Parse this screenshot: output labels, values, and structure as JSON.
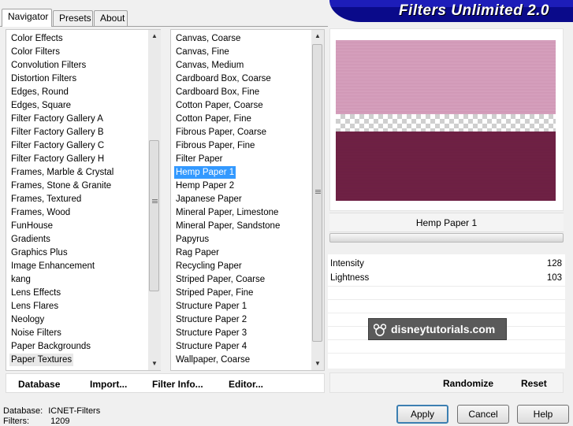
{
  "app": {
    "title": "Filters Unlimited 2.0"
  },
  "tabs": [
    {
      "label": "Navigator",
      "active": true
    },
    {
      "label": "Presets"
    },
    {
      "label": "About"
    }
  ],
  "categories": {
    "items": [
      "Color Effects",
      "Color Filters",
      "Convolution Filters",
      "Distortion Filters",
      "Edges, Round",
      "Edges, Square",
      "Filter Factory Gallery A",
      "Filter Factory Gallery B",
      "Filter Factory Gallery C",
      "Filter Factory Gallery H",
      "Frames, Marble & Crystal",
      "Frames, Stone & Granite",
      "Frames, Textured",
      "Frames, Wood",
      "FunHouse",
      "Gradients",
      "Graphics Plus",
      "Image Enhancement",
      "kang",
      "Lens Effects",
      "Lens Flares",
      "Neology",
      "Noise Filters",
      "Paper Backgrounds",
      "Paper Textures"
    ],
    "selected": "Paper Textures"
  },
  "filters": {
    "items": [
      "Canvas, Coarse",
      "Canvas, Fine",
      "Canvas, Medium",
      "Cardboard Box, Coarse",
      "Cardboard Box, Fine",
      "Cotton Paper, Coarse",
      "Cotton Paper, Fine",
      "Fibrous Paper, Coarse",
      "Fibrous Paper, Fine",
      "Filter Paper",
      "Hemp Paper 1",
      "Hemp Paper 2",
      "Japanese Paper",
      "Mineral Paper, Limestone",
      "Mineral Paper, Sandstone",
      "Papyrus",
      "Rag Paper",
      "Recycling Paper",
      "Striped Paper, Coarse",
      "Striped Paper, Fine",
      "Structure Paper 1",
      "Structure Paper 2",
      "Structure Paper 3",
      "Structure Paper 4",
      "Wallpaper, Coarse"
    ],
    "selected": "Hemp Paper 1"
  },
  "toolbar": {
    "database": "Database",
    "import": "Import...",
    "filter_info": "Filter Info...",
    "editor": "Editor..."
  },
  "preview": {
    "filter_name": "Hemp Paper 1",
    "colors": {
      "top": "#d29ab8",
      "bottom": "#6b1d3f"
    }
  },
  "params": [
    {
      "label": "Intensity",
      "value": "128"
    },
    {
      "label": "Lightness",
      "value": "103"
    }
  ],
  "watermark": "disneytutorials.com",
  "actions": {
    "randomize": "Randomize",
    "reset": "Reset"
  },
  "status": {
    "database_label": "Database:",
    "database_value": "ICNET-Filters",
    "filters_label": "Filters:",
    "filters_value": "1209"
  },
  "buttons": {
    "apply": "Apply",
    "cancel": "Cancel",
    "help": "Help"
  },
  "icons": {
    "scroll_up": "arrow-up-icon",
    "scroll_down": "arrow-down-icon",
    "logo": "mickey-icon"
  }
}
